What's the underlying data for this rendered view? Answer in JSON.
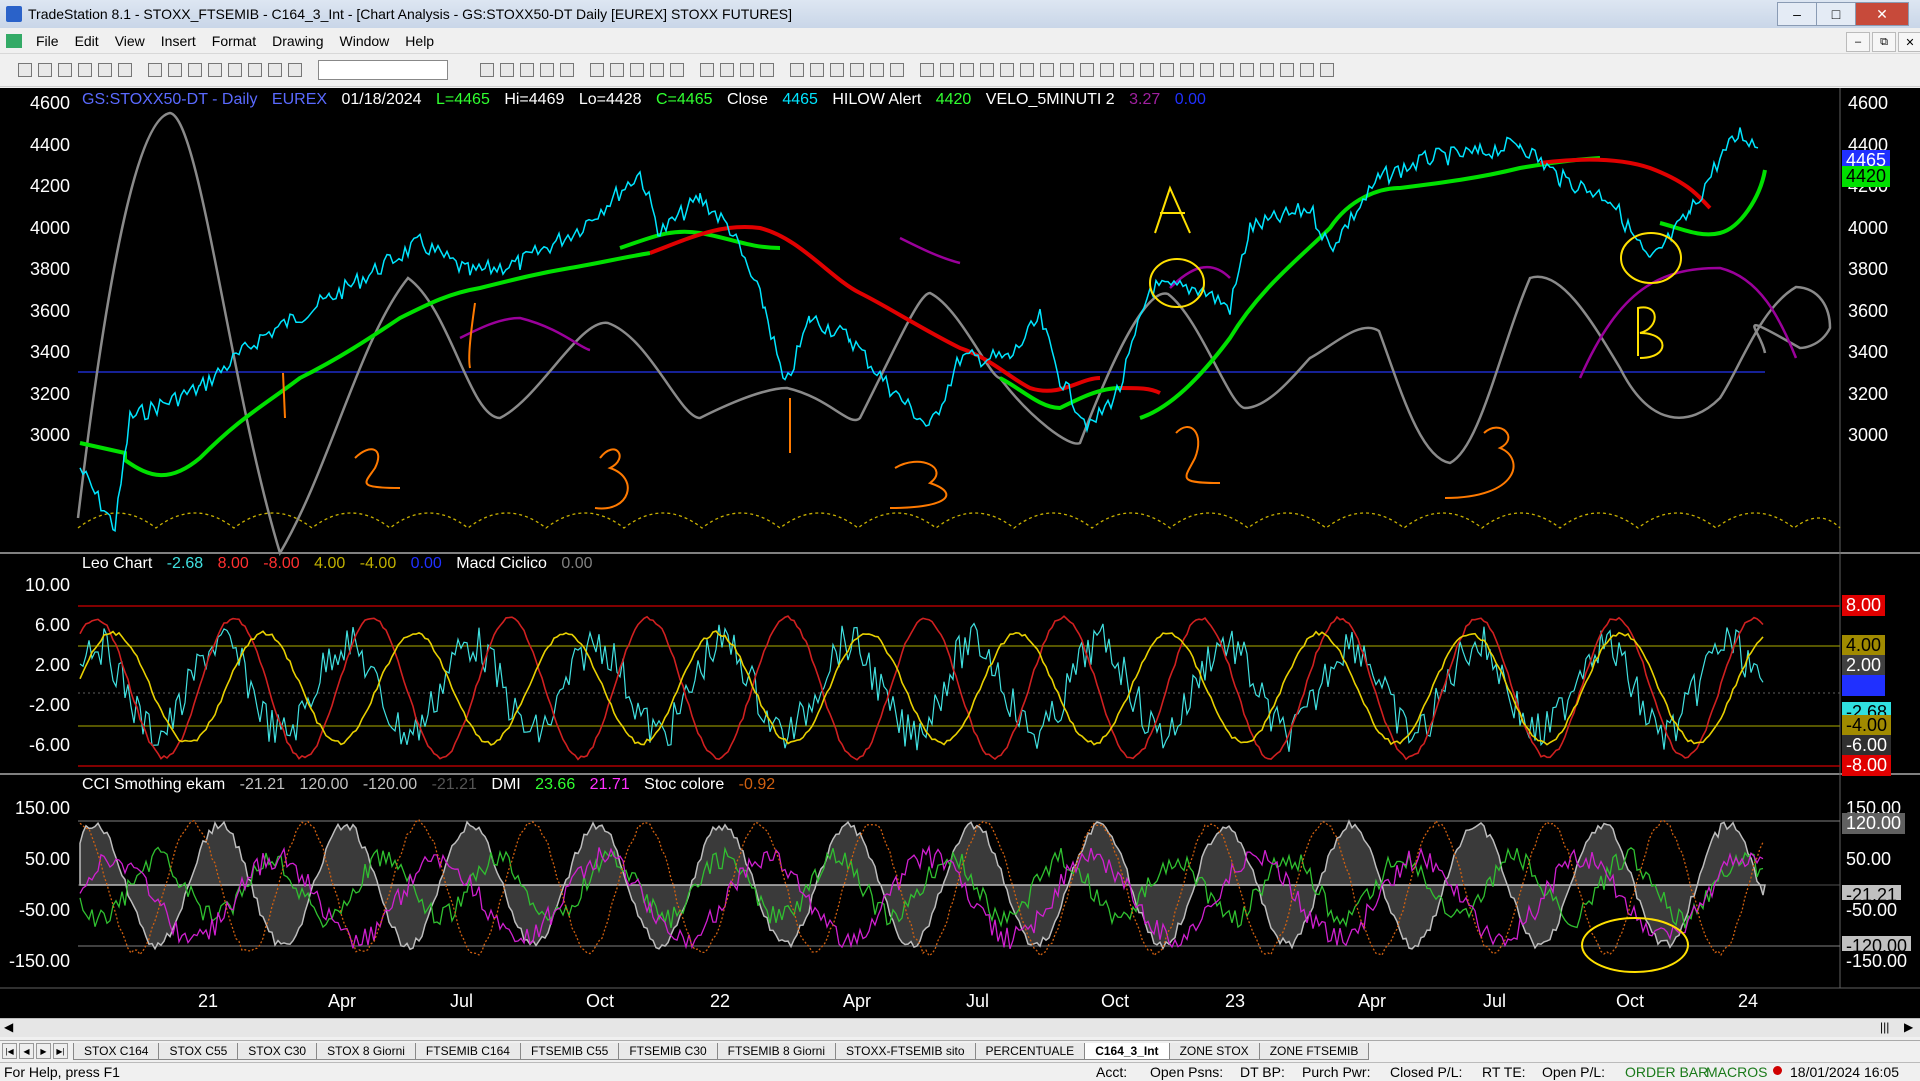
{
  "window": {
    "title": "TradeStation 8.1 - STOXX_FTSEMIB - C164_3_Int - [Chart Analysis - GS:STOXX50-DT  Daily  [EUREX] STOXX FUTURES]"
  },
  "menu": [
    "File",
    "Edit",
    "View",
    "Insert",
    "Format",
    "Drawing",
    "Window",
    "Help"
  ],
  "chart": {
    "header": {
      "symbol": "GS:STOXX50-DT - Daily",
      "exchange": "EUREX",
      "date": "01/18/2024",
      "low_last": "L=4465",
      "high": "Hi=4469",
      "low": "Lo=4428",
      "close": "C=4465",
      "close_label": "Close",
      "close_value": "4465",
      "hilow_label": "HILOW Alert",
      "hilow_value": "4420",
      "velo_label": "VELO_5MINUTI 2",
      "velo_v1": "3.27",
      "velo_v2": "0.00"
    },
    "price_axis": [
      "4600",
      "4400",
      "4200",
      "4000",
      "3800",
      "3600",
      "3400",
      "3200",
      "3000"
    ],
    "price_tags": {
      "last": "4465",
      "hilow": "4420"
    },
    "panel2": {
      "title": "Leo Chart",
      "values": [
        "-2.68",
        "8.00",
        "-8.00",
        "4.00",
        "-4.00",
        "0.00"
      ],
      "macd_label": "Macd Ciclico",
      "macd_value": "0.00",
      "axis": [
        "10.00",
        "6.00",
        "2.00",
        "-2.00",
        "-6.00"
      ],
      "tags": [
        "8.00",
        "4.00",
        "2.00",
        "0.00",
        "-2.68",
        "-4.00",
        "-6.00",
        "-8.00"
      ]
    },
    "panel3": {
      "title": "CCI Smothing ekam",
      "values": [
        "-21.21",
        "120.00",
        "-120.00",
        "-21.21"
      ],
      "dmi_label": "DMI",
      "dmi_values": [
        "23.66",
        "21.71"
      ],
      "stoc_label": "Stoc colore",
      "stoc_value": "-0.92",
      "axis": [
        "150.00",
        "50.00",
        "-50.00",
        "-150.00"
      ],
      "tags": [
        "150.00",
        "120.00",
        "50.00",
        "-21.21",
        "-50.00",
        "-120.00",
        "-150.00"
      ]
    },
    "time_axis": [
      "21",
      "Apr",
      "Jul",
      "Oct",
      "22",
      "Apr",
      "Jul",
      "Oct",
      "23",
      "Apr",
      "Jul",
      "Oct",
      "24"
    ],
    "annotations": [
      "1",
      "2",
      "3",
      "1",
      "3",
      "A",
      "2",
      "3",
      "B"
    ],
    "colors": {
      "background": "#000000",
      "price": "#00e5ff",
      "hilow_up": "#00e000",
      "hilow_down": "#e00000",
      "cycle": "#a000a0",
      "handwriting": "#ff7a00",
      "circle": "#ffe000"
    }
  },
  "sheet_tabs": [
    "STOX C164",
    "STOX C55",
    "STOX  C30",
    "STOX  8 Giorni",
    "FTSEMIB C164",
    "FTSEMIB C55",
    "FTSEMIB C30",
    "FTSEMIB  8 Giorni",
    "STOXX-FTSEMIB sito",
    "PERCENTUALE",
    "C164_3_Int",
    "ZONE STOX",
    "ZONE FTSEMIB"
  ],
  "active_tab": "C164_3_Int",
  "status": {
    "help": "For Help, press F1",
    "acct": "Acct:",
    "open_psns": "Open Psns:",
    "dt_bp": "DT BP:",
    "purch_pwr": "Purch Pwr:",
    "closed_pl": "Closed P/L:",
    "rt_te": "RT TE:",
    "open_pl": "Open P/L:",
    "order_bar": "ORDER BAR",
    "macros": "MACROS",
    "datetime": "18/01/2024 16:05"
  }
}
